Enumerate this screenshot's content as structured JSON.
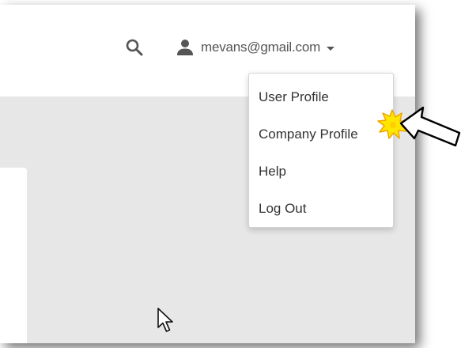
{
  "header": {
    "search_icon": "search-icon",
    "user_icon": "user-icon",
    "user_email": "mevans@gmail.com"
  },
  "dropdown": {
    "items": [
      {
        "label": "User Profile"
      },
      {
        "label": "Company Profile"
      },
      {
        "label": "Help"
      },
      {
        "label": "Log Out"
      }
    ]
  },
  "colors": {
    "background": "#e7e7e7",
    "header": "#ffffff",
    "text": "#333333",
    "icon": "#555555",
    "burst_fill": "#ffe600",
    "burst_outline": "#f0a400",
    "arrow_fill": "#ffffff",
    "arrow_outline": "#000000"
  }
}
